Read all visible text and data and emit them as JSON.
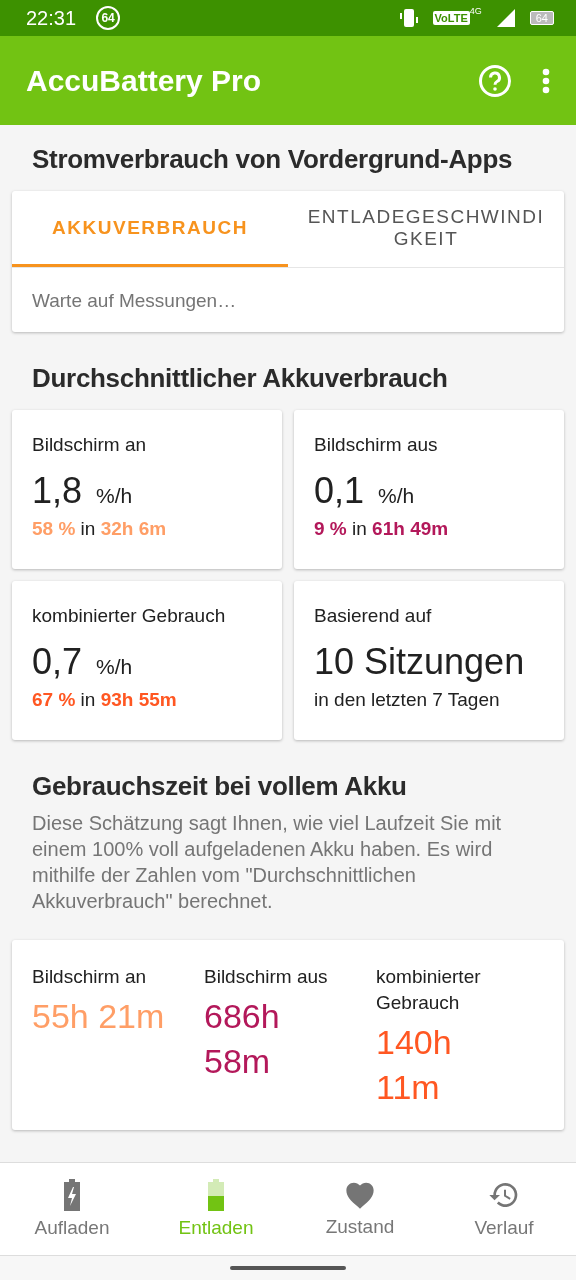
{
  "status_bar": {
    "time": "22:31",
    "badge": "64",
    "network_badge": "VoLTE",
    "network_type": "4G",
    "battery": "64"
  },
  "app_bar": {
    "title": "AccuBattery Pro"
  },
  "foreground_section": {
    "title": "Stromverbrauch von Vordergrund-Apps",
    "tabs": [
      {
        "label": "AKKUVERBRAUCH",
        "selected": true
      },
      {
        "label": "ENTLADEGESCHWINDIGKEIT",
        "selected": false
      }
    ],
    "message": "Warte auf Messungen…"
  },
  "average_section": {
    "title": "Durchschnittlicher Akkuverbrauch",
    "cards": [
      {
        "kind": "rate",
        "label": "Bildschirm an",
        "value": "1,8",
        "unit": "%/h",
        "summary": "**58 %** in **32h 6m**",
        "color": "#ff9e66"
      },
      {
        "kind": "rate",
        "label": "Bildschirm aus",
        "value": "0,1",
        "unit": "%/h",
        "summary": "**9 %** in **61h 49m**",
        "color": "#b3185a"
      },
      {
        "kind": "rate",
        "label": "kombinierter Gebrauch",
        "value": "0,7",
        "unit": "%/h",
        "summary": "**67 %** in **93h 55m**",
        "color": "#ff5722"
      },
      {
        "kind": "sessions",
        "label": "Basierend auf",
        "value": "10 Sitzungen",
        "caption": "in den letzten 7 Tagen"
      }
    ]
  },
  "full_battery_section": {
    "title": "Gebrauchszeit bei vollem Akku",
    "description": "Diese Schätzung sagt Ihnen, wie viel Laufzeit Sie mit einem 100% voll aufgeladenen Akku haben. Es wird mithilfe der Zahlen vom \"Durchschnittlichen Akkuverbrauch\" berechnet.",
    "columns": [
      {
        "label": "Bildschirm an",
        "value": "55h 21m",
        "color": "#ff9e66"
      },
      {
        "label": "Bildschirm aus",
        "value": "686h 58m",
        "color": "#b3185a"
      },
      {
        "label": "kombinierter Gebrauch",
        "value": "140h 11m",
        "color": "#ff5722"
      }
    ]
  },
  "bottom_nav": [
    {
      "label": "Aufladen",
      "kind": "charging",
      "selected": false
    },
    {
      "label": "Entladen",
      "kind": "battery",
      "selected": true
    },
    {
      "label": "Zustand",
      "kind": "heart",
      "selected": false
    },
    {
      "label": "Verlauf",
      "kind": "history",
      "selected": false
    }
  ]
}
